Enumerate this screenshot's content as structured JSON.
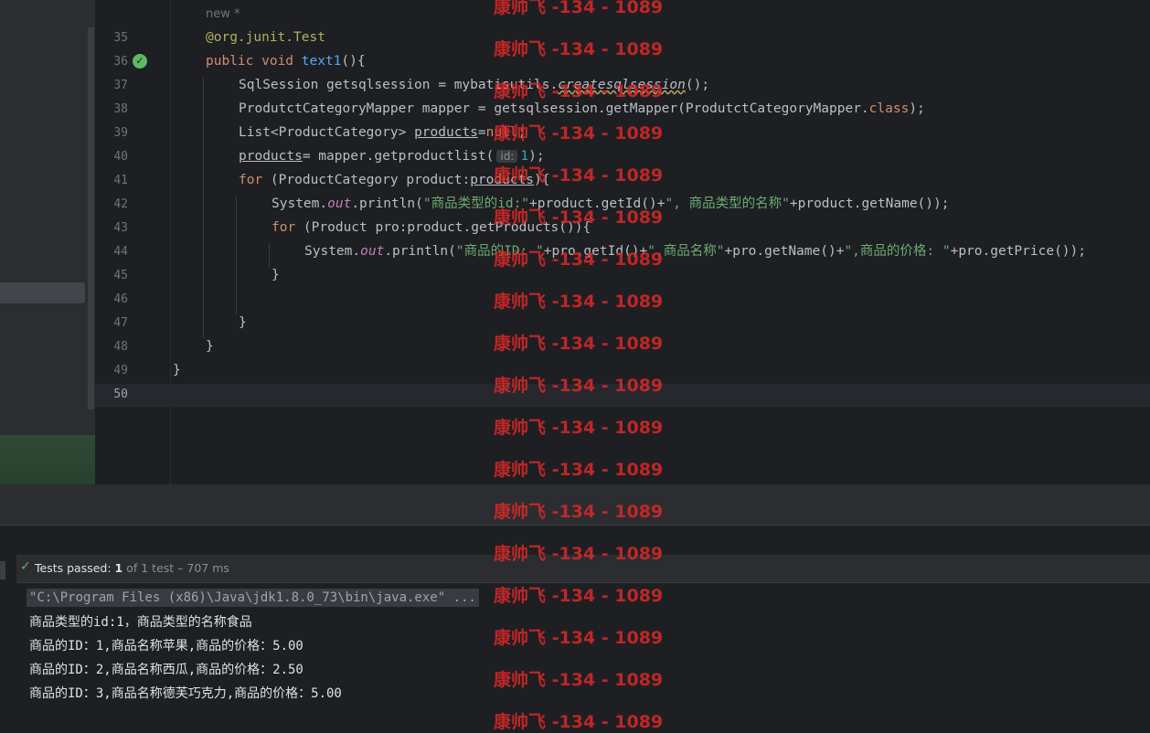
{
  "editor": {
    "hint": "new *",
    "lines": [
      {
        "n": "35",
        "html": "<span class='an'>@org.junit.Test</span>"
      },
      {
        "n": "36",
        "html": "<span class='kw'>public void</span> <span class='fn'>text1</span>(){"
      },
      {
        "n": "37",
        "html": "SqlSession getsqlsession = mybatisutils.<span class='squig'>createsqlsession</span>();"
      },
      {
        "n": "38",
        "html": "ProdutctCategoryMapper mapper = getsqlsession.getMapper(ProdutctCategoryMapper.<span class='kw'>class</span>);"
      },
      {
        "n": "39",
        "html": "List&lt;ProductCategory&gt; <span class='und'>products</span>=<span class='kw'>null</span>;"
      },
      {
        "n": "40",
        "html": "<span class='und'>products</span>= mapper.getproductlist(<span class='inlay'>id:</span><span class='num'>1</span>);"
      },
      {
        "n": "41",
        "html": "<span class='kw'>for</span> (ProductCategory product:<span class='und'>products</span>){"
      },
      {
        "n": "42",
        "html": "System.<span class='it'>out</span>.println(<span class='str'>\"商品类型的id:\"</span>+product.getId()+<span class='str'>\", 商品类型的名称\"</span>+product.getName());"
      },
      {
        "n": "43",
        "html": "<span class='kw'>for</span> (Product pro:product.getProducts()){"
      },
      {
        "n": "44",
        "html": "System.<span class='it'>out</span>.println(<span class='str'>\"商品的ID: \"</span>+pro.getId()+<span class='str'>\",商品名称\"</span>+pro.getName()+<span class='str'>\",商品的价格: \"</span>+pro.getPrice());"
      },
      {
        "n": "45",
        "html": "}"
      },
      {
        "n": "46",
        "html": ""
      },
      {
        "n": "47",
        "html": "}"
      },
      {
        "n": "48",
        "html": "}"
      },
      {
        "n": "49",
        "html": "}"
      },
      {
        "n": "50",
        "html": ""
      }
    ]
  },
  "tests": {
    "label": "Tests passed:",
    "passed": "1",
    "rest": "of 1 test – 707 ms"
  },
  "console": {
    "cmd": "\"C:\\Program Files (x86)\\Java\\jdk1.8.0_73\\bin\\java.exe\" ...",
    "lines": [
      "商品类型的id:1，商品类型的名称食品",
      "商品的ID：1,商品名称苹果,商品的价格：5.00",
      "商品的ID：2,商品名称西瓜,商品的价格：2.50",
      "商品的ID：3,商品名称德芙巧克力,商品的价格：5.00"
    ]
  },
  "watermark": "康帅飞 -134 - 1089"
}
